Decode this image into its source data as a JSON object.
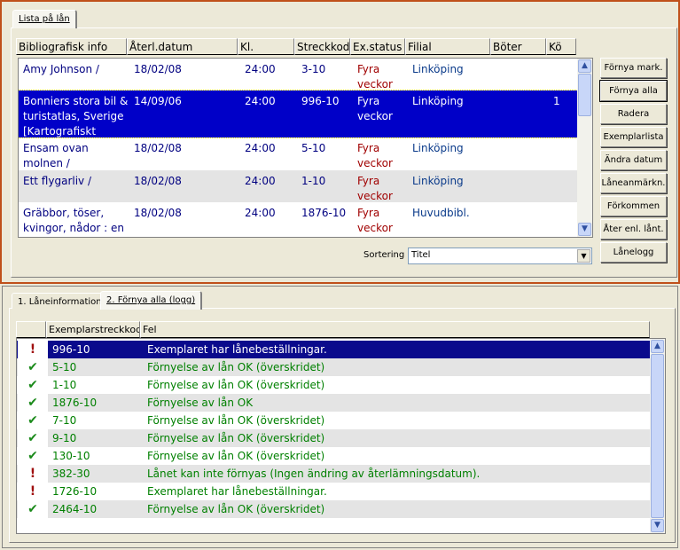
{
  "top_tab": "Lista på lån",
  "columns": [
    "Bibliografisk info",
    "Återl.datum",
    "Kl.",
    "Streckkod",
    "Ex.status",
    "Filial",
    "Böter",
    "Kö"
  ],
  "loans": [
    {
      "title": "Amy Johnson /",
      "date": "18/02/08",
      "time": "24:00",
      "barcode": "3-10",
      "status": "Fyra veckor",
      "branch": "Linköping",
      "fines": "",
      "queue": ""
    },
    {
      "title": "Bonniers stora bil & turistatlas, Sverige [Kartografiskt",
      "date": "14/09/06",
      "time": "24:00",
      "barcode": "996-10",
      "status": "Fyra veckor",
      "branch": "Linköping",
      "fines": "",
      "queue": "1",
      "selected": true
    },
    {
      "title": "Ensam ovan molnen /",
      "date": "18/02/08",
      "time": "24:00",
      "barcode": "5-10",
      "status": "Fyra veckor",
      "branch": "Linköping",
      "fines": "",
      "queue": ""
    },
    {
      "title": "Ett flygarliv /",
      "date": "18/02/08",
      "time": "24:00",
      "barcode": "1-10",
      "status": "Fyra veckor",
      "branch": "Linköping",
      "fines": "",
      "queue": ""
    },
    {
      "title": "Gräbbor, töser, kvingor, nådor : en",
      "date": "18/02/08",
      "time": "24:00",
      "barcode": "1876-10",
      "status": "Fyra veckor",
      "branch": "Huvudbibl.",
      "fines": "",
      "queue": ""
    }
  ],
  "buttons": [
    "Förnya mark.",
    "Förnya alla",
    "Radera",
    "Exemplarlista",
    "Ändra datum",
    "Låneanmärkn.",
    "Förkommen",
    "Åter enl. lånt.",
    "Lånelogg"
  ],
  "sort_label": "Sortering",
  "sort_value": "Titel",
  "bottom_tabs": [
    "1. Låneinformation",
    "2. Förnya alla (logg)"
  ],
  "log_columns": [
    "",
    "Exemplarstreckkod",
    "Fel"
  ],
  "log": [
    {
      "icon": "warning",
      "barcode": "996-10",
      "message": "Exemplaret har lånebeställningar.",
      "selected": true
    },
    {
      "icon": "check",
      "barcode": "5-10",
      "message": "Förnyelse av lån OK (överskridet)"
    },
    {
      "icon": "check",
      "barcode": "1-10",
      "message": "Förnyelse av lån OK (överskridet)"
    },
    {
      "icon": "check",
      "barcode": "1876-10",
      "message": "Förnyelse av lån OK"
    },
    {
      "icon": "check",
      "barcode": "7-10",
      "message": "Förnyelse av lån OK (överskridet)"
    },
    {
      "icon": "check",
      "barcode": "9-10",
      "message": "Förnyelse av lån OK (överskridet)"
    },
    {
      "icon": "check",
      "barcode": "130-10",
      "message": "Förnyelse av lån OK (överskridet)"
    },
    {
      "icon": "warning",
      "barcode": "382-30",
      "message": "Lånet kan inte förnyas (Ingen ändring av återlämningsdatum)."
    },
    {
      "icon": "warning",
      "barcode": "1726-10",
      "message": "Exemplaret har lånebeställningar."
    },
    {
      "icon": "check",
      "barcode": "2464-10",
      "message": "Förnyelse av lån OK (överskridet)"
    }
  ],
  "colors": {
    "selection": "#0000c8",
    "ok": "#008000",
    "status": "#a00000",
    "branch": "#0a3a8a",
    "frame": "#c0501a"
  }
}
